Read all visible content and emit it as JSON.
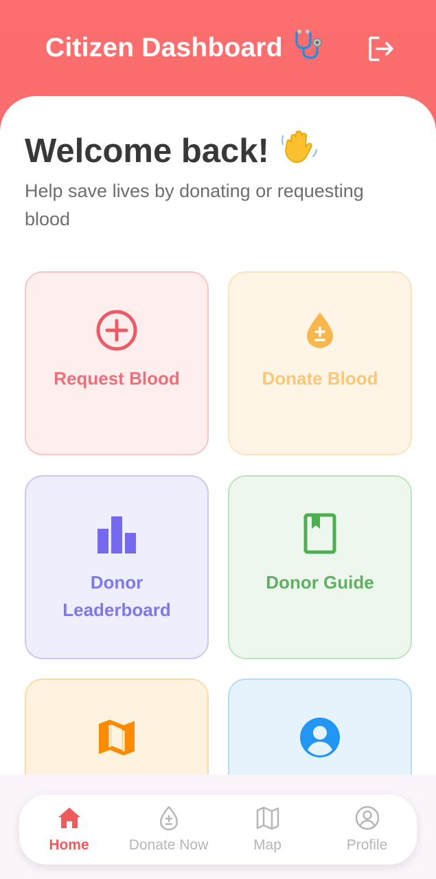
{
  "header": {
    "title": "Citizen Dashboard",
    "title_icon": "stethoscope-icon",
    "logout_icon": "logout-icon"
  },
  "welcome": {
    "heading": "Welcome back!",
    "heading_icon": "waving-hand-icon",
    "subtitle": "Help save lives by donating or requesting blood"
  },
  "cards": [
    {
      "label": "Request Blood",
      "icon": "plus-circle-icon",
      "color": "#ec5a66",
      "bg": "#feeeee",
      "border": "#f8c4c8"
    },
    {
      "label": "Donate Blood",
      "icon": "blood-drop-icon",
      "color": "#f8be5a",
      "bg": "#fff5e7",
      "border": "#fbe4bd"
    },
    {
      "label": "Donor Leaderboard",
      "icon": "bar-chart-icon",
      "color": "#7469ef",
      "bg": "#efeefd",
      "border": "#c9c6f3"
    },
    {
      "label": "Donor Guide",
      "icon": "book-icon",
      "color": "#4caf50",
      "bg": "#edf7ee",
      "border": "#bfe3c1"
    },
    {
      "label": "",
      "icon": "map-icon",
      "color": "#fb8c00",
      "bg": "#fff3e0",
      "border": "#fcd9a9"
    },
    {
      "label": "",
      "icon": "account-circle-icon",
      "color": "#2196f3",
      "bg": "#e6f3fd",
      "border": "#b4dbf7"
    }
  ],
  "nav": {
    "items": [
      {
        "label": "Home",
        "icon": "home-icon",
        "active": true
      },
      {
        "label": "Donate Now",
        "icon": "blood-drop-outline-icon",
        "active": false
      },
      {
        "label": "Map",
        "icon": "map-outline-icon",
        "active": false
      },
      {
        "label": "Profile",
        "icon": "profile-outline-icon",
        "active": false
      }
    ],
    "active_color": "#ef5b5b",
    "inactive_color": "#b6b6b6"
  }
}
